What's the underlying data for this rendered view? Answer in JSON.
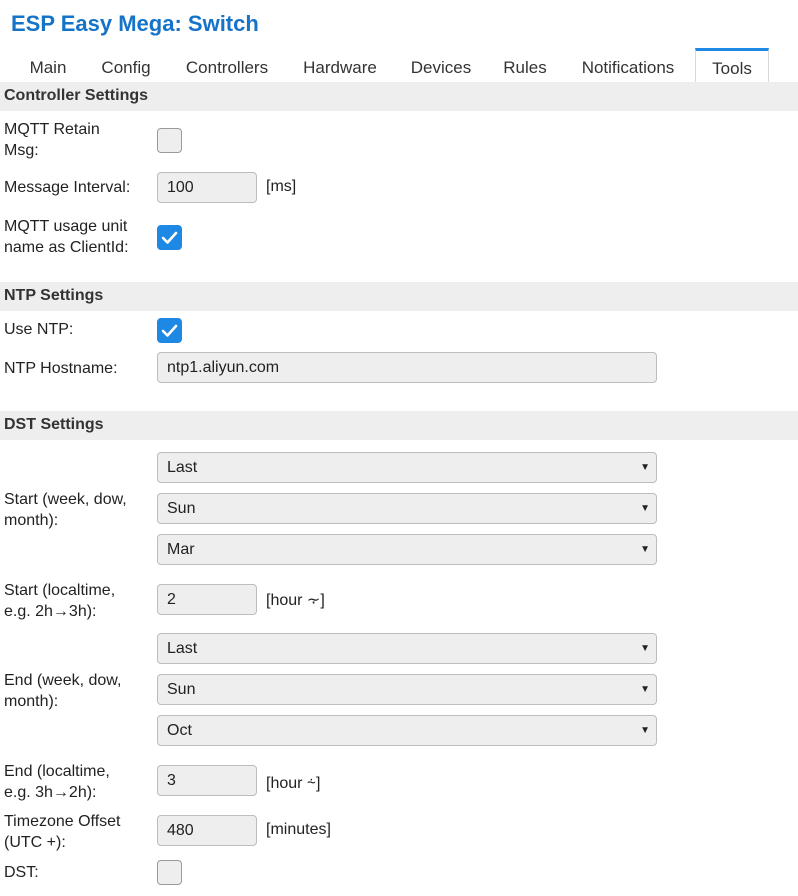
{
  "app": {
    "title": "ESP Easy Mega: Switch"
  },
  "tabs": [
    "Main",
    "Config",
    "Controllers",
    "Hardware",
    "Devices",
    "Rules",
    "Notifications",
    "Tools"
  ],
  "colors": {
    "accent": "#1e88e5",
    "title": "#1573c8"
  },
  "controller": {
    "section_title": "Controller Settings",
    "retain_label_1": "MQTT Retain",
    "retain_label_2": "Msg:",
    "retain_checked": false,
    "interval_label": "Message Interval:",
    "interval_value": "100",
    "interval_unit": "[ms]",
    "clientid_label_1": "MQTT usage unit",
    "clientid_label_2": "name as ClientId:",
    "clientid_checked": true
  },
  "ntp": {
    "section_title": "NTP Settings",
    "use_label": "Use NTP:",
    "use_checked": true,
    "hostname_label": "NTP Hostname:",
    "hostname_value": "ntp1.aliyun.com"
  },
  "dst": {
    "section_title": "DST Settings",
    "start_label_1": "Start (week, dow,",
    "start_label_2": "month):",
    "start_week": "Last",
    "start_dow": "Sun",
    "start_month": "Mar",
    "start_time_label_1": "Start (localtime,",
    "start_time_label_2": "e.g. 2h→3h):",
    "start_time_value": "2",
    "start_time_unit": "[hour ⸟]",
    "end_label_1": "End (week, dow,",
    "end_label_2": "month):",
    "end_week": "Last",
    "end_dow": "Sun",
    "end_month": "Oct",
    "end_time_label_1": "End (localtime,",
    "end_time_label_2": "e.g. 3h→2h):",
    "end_time_value": "3",
    "end_time_unit": "[hour ⸞]",
    "tz_label_1": "Timezone Offset",
    "tz_label_2": "(UTC +):",
    "tz_value": "480",
    "tz_unit": "[minutes]",
    "dst_label": "DST:",
    "dst_checked": false
  }
}
